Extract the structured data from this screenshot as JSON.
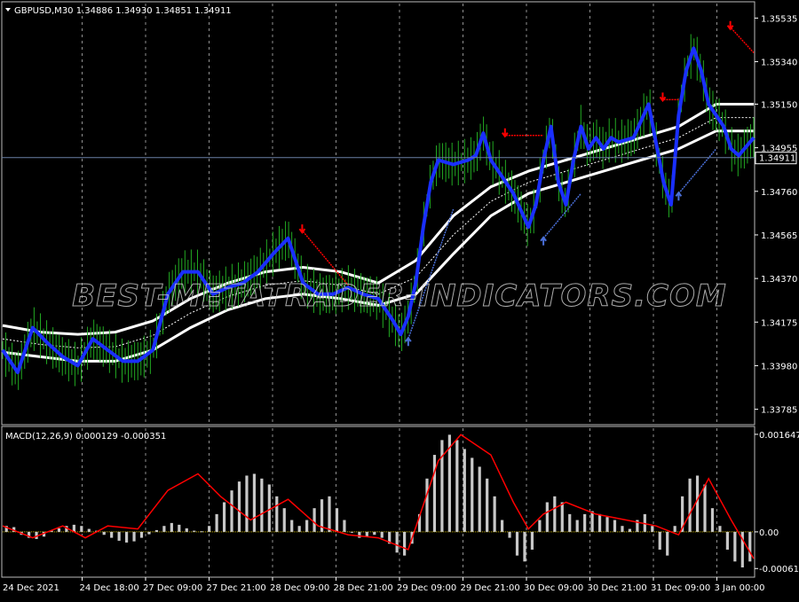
{
  "symbol_header": "GBPUSD,M30  1.34886 1.34930 1.34851 1.34911",
  "macd_header": "MACD(12,26,9) 0.000129 -0.000351",
  "watermark": "BEST-METATRADER-INDICATORS.COM",
  "current_price_label": "1.34911",
  "colors": {
    "background": "#000000",
    "ma_band": "#ffffff",
    "trend_line": "#1a2fff",
    "candle": "#22aa22",
    "sell_arrow": "#ff0000",
    "buy_arrow": "#4a6fd8",
    "macd_signal": "#ff0000",
    "macd_hist": "#c8c8c8",
    "zero_line": "#c8b400",
    "grid": "#ffffff"
  },
  "price_axis": [
    "1.35535",
    "1.35340",
    "1.35150",
    "1.34955",
    "1.34760",
    "1.34565",
    "1.34370",
    "1.34175",
    "1.33980",
    "1.33785"
  ],
  "macd_axis": [
    "0.001647",
    "0.00",
    "-0.000619"
  ],
  "time_axis": [
    "24 Dec 2021",
    "24 Dec 18:00",
    "27 Dec 09:00",
    "27 Dec 21:00",
    "28 Dec 09:00",
    "28 Dec 21:00",
    "29 Dec 09:00",
    "29 Dec 21:00",
    "30 Dec 09:00",
    "30 Dec 21:00",
    "31 Dec 09:00",
    "3 Jan 00:00"
  ],
  "chart_data": {
    "type": "line",
    "ylim": [
      1.3372,
      1.356
    ],
    "current_price": 1.34911,
    "trend": [
      [
        0,
        1.3405
      ],
      [
        0.02,
        1.3395
      ],
      [
        0.04,
        1.3415
      ],
      [
        0.06,
        1.3408
      ],
      [
        0.08,
        1.3402
      ],
      [
        0.1,
        1.3398
      ],
      [
        0.12,
        1.341
      ],
      [
        0.14,
        1.3405
      ],
      [
        0.16,
        1.34
      ],
      [
        0.18,
        1.34
      ],
      [
        0.2,
        1.3405
      ],
      [
        0.22,
        1.343
      ],
      [
        0.24,
        1.344
      ],
      [
        0.26,
        1.344
      ],
      [
        0.28,
        1.343
      ],
      [
        0.3,
        1.3433
      ],
      [
        0.32,
        1.3435
      ],
      [
        0.34,
        1.344
      ],
      [
        0.36,
        1.3448
      ],
      [
        0.38,
        1.3455
      ],
      [
        0.39,
        1.3445
      ],
      [
        0.4,
        1.3435
      ],
      [
        0.42,
        1.343
      ],
      [
        0.44,
        1.343
      ],
      [
        0.46,
        1.3433
      ],
      [
        0.48,
        1.343
      ],
      [
        0.5,
        1.3428
      ],
      [
        0.52,
        1.3418
      ],
      [
        0.53,
        1.3412
      ],
      [
        0.54,
        1.342
      ],
      [
        0.55,
        1.3435
      ],
      [
        0.56,
        1.346
      ],
      [
        0.57,
        1.348
      ],
      [
        0.58,
        1.349
      ],
      [
        0.6,
        1.3488
      ],
      [
        0.62,
        1.349
      ],
      [
        0.63,
        1.3492
      ],
      [
        0.64,
        1.3502
      ],
      [
        0.65,
        1.349
      ],
      [
        0.66,
        1.3485
      ],
      [
        0.68,
        1.3475
      ],
      [
        0.7,
        1.346
      ],
      [
        0.71,
        1.347
      ],
      [
        0.72,
        1.349
      ],
      [
        0.73,
        1.3505
      ],
      [
        0.74,
        1.348
      ],
      [
        0.75,
        1.347
      ],
      [
        0.76,
        1.349
      ],
      [
        0.77,
        1.3505
      ],
      [
        0.78,
        1.3495
      ],
      [
        0.79,
        1.35
      ],
      [
        0.8,
        1.3495
      ],
      [
        0.81,
        1.35
      ],
      [
        0.82,
        1.3498
      ],
      [
        0.84,
        1.35
      ],
      [
        0.86,
        1.3515
      ],
      [
        0.88,
        1.348
      ],
      [
        0.89,
        1.347
      ],
      [
        0.9,
        1.351
      ],
      [
        0.91,
        1.353
      ],
      [
        0.92,
        1.354
      ],
      [
        0.93,
        1.353
      ],
      [
        0.94,
        1.3515
      ],
      [
        0.95,
        1.351
      ],
      [
        0.96,
        1.3505
      ],
      [
        0.97,
        1.3495
      ],
      [
        0.98,
        1.3492
      ],
      [
        1.0,
        1.35
      ]
    ],
    "band_upper": [
      [
        0,
        1.3416
      ],
      [
        0.05,
        1.3413
      ],
      [
        0.1,
        1.3412
      ],
      [
        0.15,
        1.3413
      ],
      [
        0.2,
        1.3418
      ],
      [
        0.25,
        1.3428
      ],
      [
        0.3,
        1.3435
      ],
      [
        0.35,
        1.344
      ],
      [
        0.4,
        1.3442
      ],
      [
        0.45,
        1.344
      ],
      [
        0.5,
        1.3435
      ],
      [
        0.55,
        1.3445
      ],
      [
        0.6,
        1.3465
      ],
      [
        0.65,
        1.3478
      ],
      [
        0.7,
        1.3485
      ],
      [
        0.75,
        1.349
      ],
      [
        0.8,
        1.3495
      ],
      [
        0.85,
        1.35
      ],
      [
        0.9,
        1.3505
      ],
      [
        0.95,
        1.3515
      ],
      [
        1.0,
        1.3515
      ]
    ],
    "band_lower": [
      [
        0,
        1.3404
      ],
      [
        0.05,
        1.3402
      ],
      [
        0.1,
        1.34
      ],
      [
        0.15,
        1.34
      ],
      [
        0.2,
        1.3405
      ],
      [
        0.25,
        1.3415
      ],
      [
        0.3,
        1.3423
      ],
      [
        0.35,
        1.3428
      ],
      [
        0.4,
        1.343
      ],
      [
        0.45,
        1.3428
      ],
      [
        0.5,
        1.3425
      ],
      [
        0.55,
        1.343
      ],
      [
        0.6,
        1.3448
      ],
      [
        0.65,
        1.3465
      ],
      [
        0.7,
        1.3475
      ],
      [
        0.75,
        1.348
      ],
      [
        0.8,
        1.3485
      ],
      [
        0.85,
        1.349
      ],
      [
        0.9,
        1.3495
      ],
      [
        0.95,
        1.3503
      ],
      [
        1.0,
        1.3503
      ]
    ],
    "sell_signals": [
      {
        "x": 0.4,
        "y": 1.3458,
        "x2": 0.46,
        "y2": 1.3434
      },
      {
        "x": 0.67,
        "y": 1.3501,
        "x2": 0.72,
        "y2": 1.3501
      },
      {
        "x": 0.88,
        "y": 1.3517,
        "x2": 0.9,
        "y2": 1.3517
      },
      {
        "x": 0.97,
        "y": 1.3549,
        "x2": 1.0,
        "y2": 1.3538
      }
    ],
    "buy_signals": [
      {
        "x": 0.54,
        "y": 1.341,
        "x2": 0.6,
        "y2": 1.3468
      },
      {
        "x": 0.72,
        "y": 1.3455,
        "x2": 0.77,
        "y2": 1.3475
      },
      {
        "x": 0.9,
        "y": 1.3475,
        "x2": 0.95,
        "y2": 1.3495
      }
    ],
    "macd_ylim": [
      -0.00075,
      0.00175
    ],
    "macd_hist": [
      0.0001,
      8e-05,
      -5e-05,
      -0.0001,
      -0.00012,
      -8e-05,
      2e-05,
      6e-05,
      0.0001,
      0.00012,
      0.0001,
      5e-05,
      2e-05,
      -5e-05,
      -0.0001,
      -0.00015,
      -0.00018,
      -0.00016,
      -0.0001,
      -4e-05,
      3e-05,
      0.0001,
      0.00015,
      0.00012,
      6e-05,
      2e-05,
      1e-05,
      0.0001,
      0.0003,
      0.0005,
      0.0007,
      0.00085,
      0.00095,
      0.00098,
      0.0009,
      0.0008,
      0.0006,
      0.0004,
      0.0002,
      0.0001,
      0.0002,
      0.0004,
      0.00055,
      0.0006,
      0.0004,
      0.0002,
      0,
      -0.0001,
      -8e-05,
      -5e-05,
      -0.0001,
      -0.0002,
      -0.00035,
      -0.0004,
      -0.0002,
      0.0003,
      0.0009,
      0.0013,
      0.00155,
      0.00164,
      0.00155,
      0.0014,
      0.00125,
      0.0011,
      0.0009,
      0.0006,
      0.0002,
      -0.0001,
      -0.0004,
      -0.0005,
      -0.0003,
      0.0002,
      0.0005,
      0.0006,
      0.0005,
      0.0003,
      0.0002,
      0.0003,
      0.00035,
      0.0003,
      0.00025,
      0.0002,
      0.0001,
      5e-05,
      0.0002,
      0.0003,
      0.0001,
      -0.0003,
      -0.0004,
      0.0001,
      0.0006,
      0.0009,
      0.00095,
      0.0008,
      0.0004,
      0.0001,
      -0.0003,
      -0.0005,
      -0.0006,
      -0.0005
    ],
    "macd_signal_pts": [
      [
        0,
        0.0001
      ],
      [
        0.04,
        -0.0001
      ],
      [
        0.08,
        0.0001
      ],
      [
        0.11,
        -0.0001
      ],
      [
        0.14,
        0.0001
      ],
      [
        0.18,
        5e-05
      ],
      [
        0.22,
        0.0007
      ],
      [
        0.26,
        0.00098
      ],
      [
        0.29,
        0.0006
      ],
      [
        0.33,
        0.0002
      ],
      [
        0.38,
        0.00055
      ],
      [
        0.42,
        0.0001
      ],
      [
        0.46,
        -5e-05
      ],
      [
        0.5,
        -0.0001
      ],
      [
        0.54,
        -0.0003
      ],
      [
        0.58,
        0.0012
      ],
      [
        0.61,
        0.00164
      ],
      [
        0.65,
        0.0013
      ],
      [
        0.68,
        0.0005
      ],
      [
        0.7,
        5e-05
      ],
      [
        0.72,
        0.0003
      ],
      [
        0.75,
        0.0005
      ],
      [
        0.79,
        0.0003
      ],
      [
        0.83,
        0.0002
      ],
      [
        0.87,
        0.0001
      ],
      [
        0.9,
        -5e-05
      ],
      [
        0.94,
        0.0009
      ],
      [
        0.97,
        0.0002
      ],
      [
        1.0,
        -0.00045
      ]
    ]
  }
}
